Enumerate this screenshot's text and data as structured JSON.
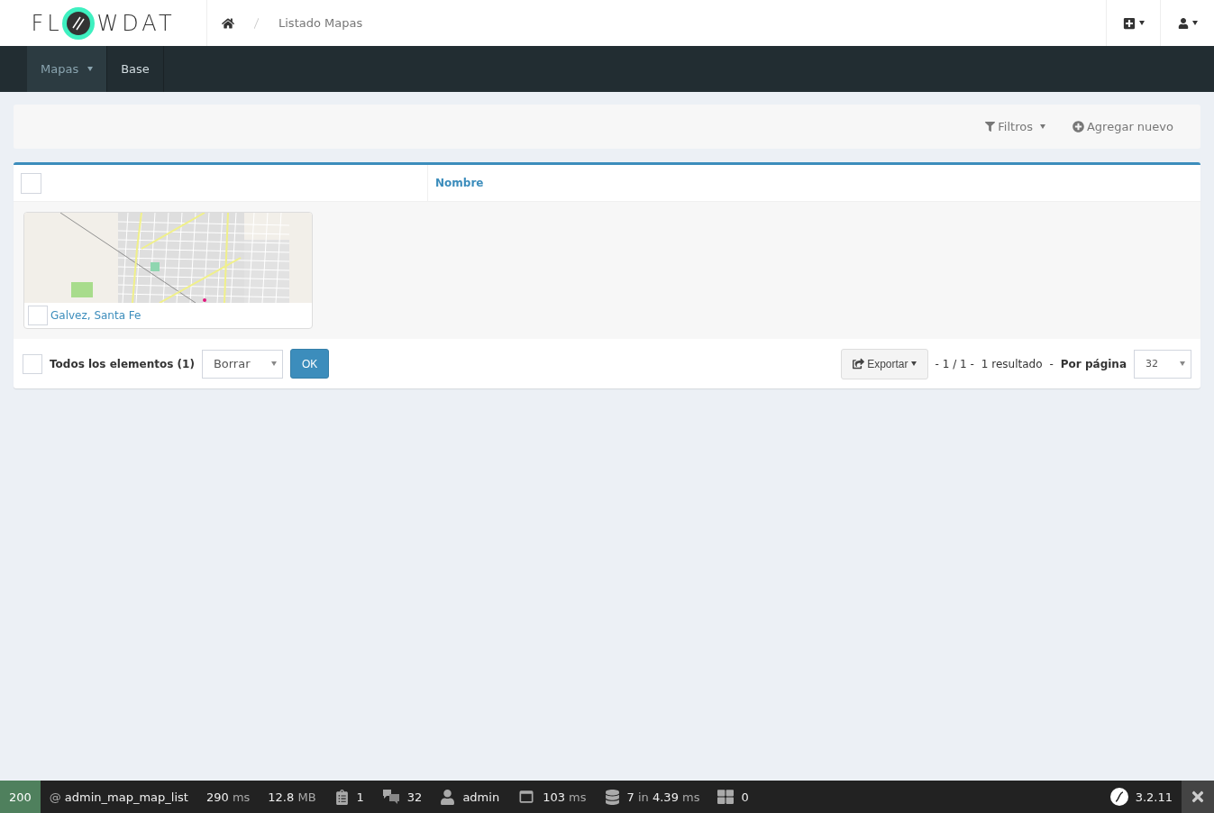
{
  "logo": {
    "left": "FL",
    "right": "WDAT"
  },
  "breadcrumb": [
    "Listado Mapas"
  ],
  "nav": [
    {
      "label": "Mapas",
      "selected": true,
      "dropdown": true
    },
    {
      "label": "Base",
      "selected": false,
      "dropdown": false
    }
  ],
  "actions": [
    "Filtros",
    "Agregar nuevo"
  ],
  "table": {
    "select_all_checked": false,
    "columns": [
      "Nombre"
    ],
    "items": [
      {
        "name": "Galvez, Santa Fe",
        "checked": false
      }
    ]
  },
  "footer": {
    "all_checked": false,
    "all_label": "Todos los elementos (1)",
    "batch_action": "Borrar",
    "ok": "OK",
    "export": "Exportar",
    "pages": "- 1 / 1 -",
    "results": "1 resultado",
    "separator": "-",
    "per_page_label": "Por página",
    "per_page": "32"
  },
  "debug_bar": {
    "status": "200",
    "route_prefix": "@",
    "route": "admin_map_map_list",
    "items": [
      {
        "kind": "time",
        "parts": [
          {
            "t": "290",
            "dim": false
          },
          {
            "t": "ms",
            "dim": true
          }
        ]
      },
      {
        "kind": "memory",
        "parts": [
          {
            "t": "12.8",
            "dim": false
          },
          {
            "t": "MB",
            "dim": true
          }
        ]
      },
      {
        "kind": "logs",
        "parts": [
          {
            "t": "1",
            "dim": false
          }
        ]
      },
      {
        "kind": "translation",
        "parts": [
          {
            "t": "32",
            "dim": false
          }
        ]
      },
      {
        "kind": "user",
        "parts": [
          {
            "t": "admin",
            "dim": false
          }
        ]
      },
      {
        "kind": "render",
        "parts": [
          {
            "t": "103",
            "dim": false
          },
          {
            "t": "ms",
            "dim": true
          }
        ]
      },
      {
        "kind": "db",
        "parts": [
          {
            "t": "7",
            "dim": false
          },
          {
            "t": "in",
            "dim": true
          },
          {
            "t": "4.39",
            "dim": false
          },
          {
            "t": "ms",
            "dim": true
          }
        ]
      },
      {
        "kind": "forms",
        "parts": [
          {
            "t": "0",
            "dim": false
          }
        ]
      }
    ],
    "version": "3.2.11"
  }
}
